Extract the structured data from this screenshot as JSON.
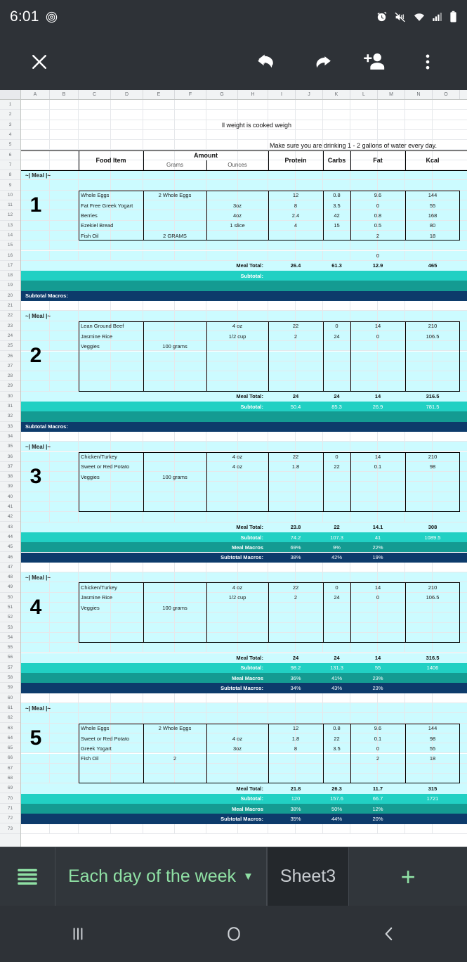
{
  "status_bar": {
    "time": "6:01",
    "icons": [
      "fingerprint-icon",
      "alarm-icon",
      "vibrate-mute-icon",
      "wifi-icon",
      "signal-icon",
      "battery-icon"
    ]
  },
  "toolbar": {
    "close_label": "✕",
    "undo_label": "undo-icon",
    "redo_label": "redo-icon",
    "add_person_label": "add-person-icon",
    "overflow_label": "more-options-icon"
  },
  "sheet": {
    "columns": [
      "A",
      "B",
      "C",
      "D",
      "E",
      "F",
      "G",
      "H",
      "I",
      "J",
      "K",
      "L",
      "M",
      "N",
      "O"
    ],
    "row_numbers": [
      1,
      2,
      3,
      4,
      5,
      6,
      7,
      8,
      9,
      10,
      11,
      12,
      13,
      14,
      15,
      16,
      17,
      18,
      19,
      20,
      21,
      22,
      23,
      24,
      25,
      26,
      27,
      28,
      29,
      30,
      31,
      32,
      33,
      34,
      35,
      36,
      37,
      38,
      39,
      40,
      41,
      42,
      43,
      44,
      45,
      46,
      47,
      48,
      49,
      50,
      51,
      52,
      53,
      54,
      55,
      56,
      57,
      58,
      59,
      60,
      61,
      62,
      63,
      64,
      65,
      66,
      67,
      68,
      69,
      70,
      71,
      72,
      73
    ],
    "notes": {
      "cooked_weight": "ll weight is cooked weigh",
      "water": "Make sure you are drinking 1 - 2 gallons of water every day."
    },
    "headers": {
      "food_item": "Food Item",
      "amount": "Amount",
      "grams": "Grams",
      "ounces": "Ounces",
      "protein": "Protein",
      "carbs": "Carbs",
      "fat": "Fat",
      "kcal": "Kcal"
    },
    "meal_tag": "~| Meal |~",
    "labels": {
      "meal_total": "Meal Total:",
      "subtotal": "Subtotal:",
      "meal_macros": "Meal Macros",
      "subtotal_macros": "Subtotal Macros:"
    },
    "meals": [
      {
        "number": "1",
        "items": [
          {
            "food": "Whole Eggs",
            "grams": "2 Whole Eggs",
            "ounces": "",
            "protein": "12",
            "carbs": "0.8",
            "fat": "9.6",
            "kcal": "144"
          },
          {
            "food": "Fat Free Greek Yogart",
            "grams": "",
            "ounces": "3oz",
            "protein": "8",
            "carbs": "3.5",
            "fat": "0",
            "kcal": "55"
          },
          {
            "food": "Berries",
            "grams": "",
            "ounces": "4oz",
            "protein": "2.4",
            "carbs": "42",
            "fat": "0.8",
            "kcal": "168"
          },
          {
            "food": "Ezekiel Bread",
            "grams": "",
            "ounces": "1 slice",
            "protein": "4",
            "carbs": "15",
            "fat": "0.5",
            "kcal": "80"
          },
          {
            "food": "Fish Oil",
            "grams": "2 GRAMS",
            "ounces": "",
            "protein": "",
            "carbs": "",
            "fat": "2",
            "kcal": "18"
          },
          {
            "food": "",
            "grams": "",
            "ounces": "",
            "protein": "",
            "carbs": "",
            "fat": "",
            "kcal": ""
          },
          {
            "food": "",
            "grams": "",
            "ounces": "",
            "protein": "",
            "carbs": "",
            "fat": "0",
            "kcal": ""
          }
        ],
        "meal_total": {
          "protein": "26.4",
          "carbs": "61.3",
          "fat": "12.9",
          "kcal": "465"
        },
        "subtotal": {
          "protein": "",
          "carbs": "",
          "fat": "",
          "kcal": ""
        },
        "meal_macros": null,
        "subtotal_macros": {
          "protein": "",
          "carbs": "",
          "fat": ""
        }
      },
      {
        "number": "2",
        "items": [
          {
            "food": "Lean Ground Beef",
            "grams": "",
            "ounces": "4 oz",
            "protein": "22",
            "carbs": "0",
            "fat": "14",
            "kcal": "210"
          },
          {
            "food": "Jasmine Rice",
            "grams": "",
            "ounces": "1/2 cup",
            "protein": "2",
            "carbs": "24",
            "fat": "0",
            "kcal": "106.5"
          },
          {
            "food": "Veggies",
            "grams": "100 grams",
            "ounces": "",
            "protein": "",
            "carbs": "",
            "fat": "",
            "kcal": ""
          },
          {
            "food": "",
            "grams": "",
            "ounces": "",
            "protein": "",
            "carbs": "",
            "fat": "",
            "kcal": ""
          },
          {
            "food": "",
            "grams": "",
            "ounces": "",
            "protein": "",
            "carbs": "",
            "fat": "",
            "kcal": ""
          },
          {
            "food": "",
            "grams": "",
            "ounces": "",
            "protein": "",
            "carbs": "",
            "fat": "",
            "kcal": ""
          },
          {
            "food": "",
            "grams": "",
            "ounces": "",
            "protein": "",
            "carbs": "",
            "fat": "",
            "kcal": ""
          }
        ],
        "meal_total": {
          "protein": "24",
          "carbs": "24",
          "fat": "14",
          "kcal": "316.5"
        },
        "subtotal": {
          "protein": "50.4",
          "carbs": "85.3",
          "fat": "26.9",
          "kcal": "781.5"
        },
        "meal_macros": null,
        "subtotal_macros": {
          "protein": "",
          "carbs": "",
          "fat": ""
        }
      },
      {
        "number": "3",
        "items": [
          {
            "food": "Chicken/Turkey",
            "grams": "",
            "ounces": "4 oz",
            "protein": "22",
            "carbs": "0",
            "fat": "14",
            "kcal": "210"
          },
          {
            "food": "Sweet or Red Potato",
            "grams": "",
            "ounces": "4 oz",
            "protein": "1.8",
            "carbs": "22",
            "fat": "0.1",
            "kcal": "98"
          },
          {
            "food": "Veggies",
            "grams": "100 grams",
            "ounces": "",
            "protein": "",
            "carbs": "",
            "fat": "",
            "kcal": ""
          },
          {
            "food": "",
            "grams": "",
            "ounces": "",
            "protein": "",
            "carbs": "",
            "fat": "",
            "kcal": ""
          },
          {
            "food": "",
            "grams": "",
            "ounces": "",
            "protein": "",
            "carbs": "",
            "fat": "",
            "kcal": ""
          },
          {
            "food": "",
            "grams": "",
            "ounces": "",
            "protein": "",
            "carbs": "",
            "fat": "",
            "kcal": ""
          }
        ],
        "meal_total": {
          "protein": "23.8",
          "carbs": "22",
          "fat": "14.1",
          "kcal": "308"
        },
        "subtotal": {
          "protein": "74.2",
          "carbs": "107.3",
          "fat": "41",
          "kcal": "1089.5"
        },
        "meal_macros": {
          "protein": "69%",
          "carbs": "9%",
          "fat": "22%"
        },
        "subtotal_macros": {
          "protein": "38%",
          "carbs": "42%",
          "fat": "19%"
        }
      },
      {
        "number": "4",
        "items": [
          {
            "food": "Chicken/Turkey",
            "grams": "",
            "ounces": "4 oz",
            "protein": "22",
            "carbs": "0",
            "fat": "14",
            "kcal": "210"
          },
          {
            "food": "Jasmine Rice",
            "grams": "",
            "ounces": "1/2 cup",
            "protein": "2",
            "carbs": "24",
            "fat": "0",
            "kcal": "106.5"
          },
          {
            "food": "Veggies",
            "grams": "100 grams",
            "ounces": "",
            "protein": "",
            "carbs": "",
            "fat": "",
            "kcal": ""
          },
          {
            "food": "",
            "grams": "",
            "ounces": "",
            "protein": "",
            "carbs": "",
            "fat": "",
            "kcal": ""
          },
          {
            "food": "",
            "grams": "",
            "ounces": "",
            "protein": "",
            "carbs": "",
            "fat": "",
            "kcal": ""
          },
          {
            "food": "",
            "grams": "",
            "ounces": "",
            "protein": "",
            "carbs": "",
            "fat": "",
            "kcal": ""
          }
        ],
        "meal_total": {
          "protein": "24",
          "carbs": "24",
          "fat": "14",
          "kcal": "316.5"
        },
        "subtotal": {
          "protein": "98.2",
          "carbs": "131.3",
          "fat": "55",
          "kcal": "1406"
        },
        "meal_macros": {
          "protein": "36%",
          "carbs": "41%",
          "fat": "23%"
        },
        "subtotal_macros": {
          "protein": "34%",
          "carbs": "43%",
          "fat": "23%"
        }
      },
      {
        "number": "5",
        "items": [
          {
            "food": "Whole Eggs",
            "grams": "2 Whole Eggs",
            "ounces": "",
            "protein": "12",
            "carbs": "0.8",
            "fat": "9.6",
            "kcal": "144"
          },
          {
            "food": "Sweet or Red Potato",
            "grams": "",
            "ounces": "4 oz",
            "protein": "1.8",
            "carbs": "22",
            "fat": "0.1",
            "kcal": "98"
          },
          {
            "food": "Greek Yogart",
            "grams": "",
            "ounces": "3oz",
            "protein": "8",
            "carbs": "3.5",
            "fat": "0",
            "kcal": "55"
          },
          {
            "food": "Fish Oil",
            "grams": "2",
            "ounces": "",
            "protein": "",
            "carbs": "",
            "fat": "2",
            "kcal": "18"
          },
          {
            "food": "",
            "grams": "",
            "ounces": "",
            "protein": "",
            "carbs": "",
            "fat": "",
            "kcal": ""
          },
          {
            "food": "",
            "grams": "",
            "ounces": "",
            "protein": "",
            "carbs": "",
            "fat": "",
            "kcal": ""
          }
        ],
        "meal_total": {
          "protein": "21.8",
          "carbs": "26.3",
          "fat": "11.7",
          "kcal": "315"
        },
        "subtotal": {
          "protein": "120",
          "carbs": "157.6",
          "fat": "66.7",
          "kcal": "1721"
        },
        "meal_macros": {
          "protein": "38%",
          "carbs": "50%",
          "fat": "12%"
        },
        "subtotal_macros": {
          "protein": "35%",
          "carbs": "44%",
          "fat": "20%"
        }
      }
    ]
  },
  "tab_bar": {
    "menu_label": "sheet-list-icon",
    "tabs": [
      {
        "label": "Each day of the week",
        "active": true,
        "caret": "▼"
      },
      {
        "label": "Sheet3",
        "active": false
      }
    ],
    "add_label": "+"
  },
  "nav_bar": {
    "recents": "|||",
    "home": "○",
    "back": "‹"
  },
  "colors": {
    "pale": "#ccfbff",
    "teal": "#21d0c3",
    "teal_dark": "#149b92",
    "navy": "#0d3b6b",
    "accent_green": "#8fe0a4",
    "chrome": "#2e3237"
  }
}
